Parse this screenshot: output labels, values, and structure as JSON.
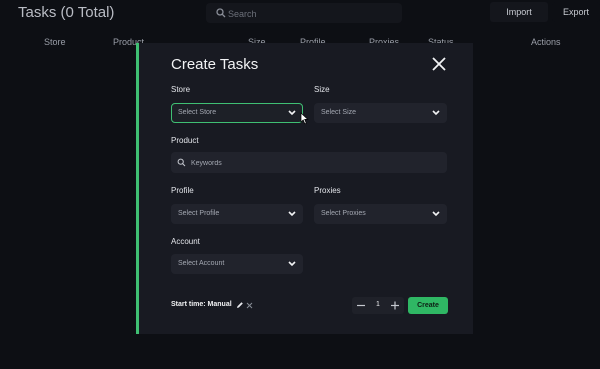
{
  "header": {
    "title": "Tasks (0 Total)",
    "search_placeholder": "Search",
    "import_label": "Import",
    "export_label": "Export"
  },
  "table": {
    "columns": [
      "Store",
      "Product",
      "Size",
      "Profile",
      "Proxies",
      "Status",
      "Actions"
    ]
  },
  "modal": {
    "title": "Create Tasks",
    "store_label": "Store",
    "store_value": "Select Store",
    "size_label": "Size",
    "size_value": "Select Size",
    "product_label": "Product",
    "product_placeholder": "Keywords",
    "profile_label": "Profile",
    "profile_value": "Select Profile",
    "proxies_label": "Proxies",
    "proxies_value": "Select Proxies",
    "account_label": "Account",
    "account_value": "Select Account",
    "start_time": "Start time: Manual",
    "quantity": "1",
    "create_label": "Create"
  },
  "colors": {
    "accent": "#3fbf73",
    "create_button": "#2fb764",
    "background": "#0d0f14",
    "modal": "#181a22",
    "field": "#21232c"
  },
  "icons": [
    "search-icon",
    "close-icon",
    "chevron-down-icon",
    "edit-icon",
    "clear-icon",
    "minus-icon",
    "plus-icon",
    "cursor-icon"
  ]
}
